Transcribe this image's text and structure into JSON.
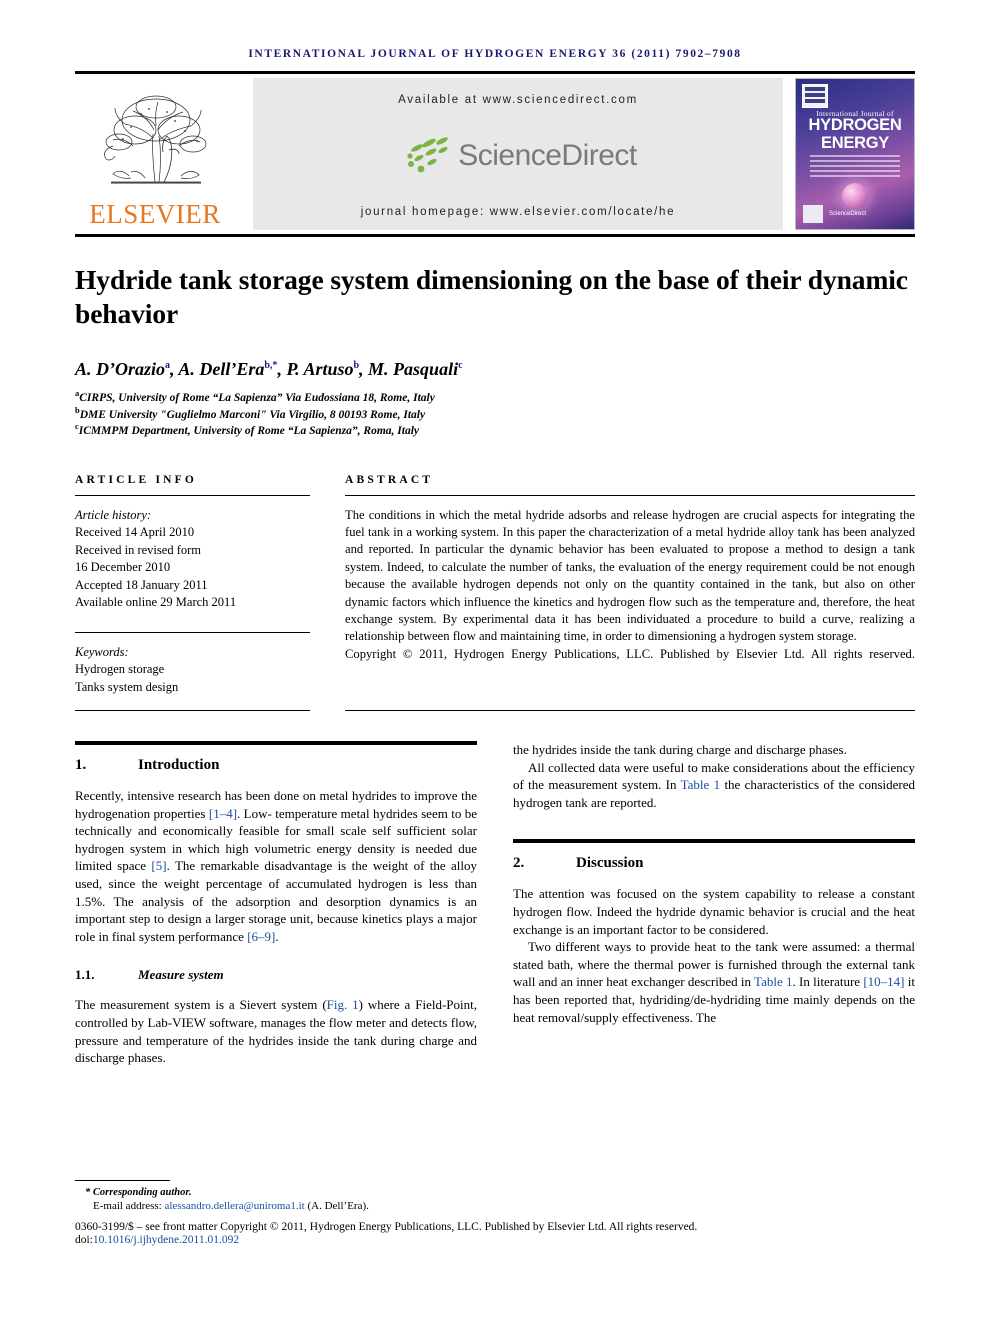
{
  "running_head": "International Journal of Hydrogen Energy 36 (2011) 7902–7908",
  "masthead": {
    "publisher_logo_text": "ELSEVIER",
    "available_at": "Available at www.sciencedirect.com",
    "sciencedirect_wordmark": "ScienceDirect",
    "journal_homepage": "journal homepage: www.elsevier.com/locate/he",
    "cover": {
      "line1": "International Journal of",
      "line2": "HYDROGEN",
      "line3": "ENERGY",
      "footer_brand": "ScienceDirect"
    }
  },
  "article": {
    "title": "Hydride tank storage system dimensioning on the base of their dynamic behavior",
    "authors": [
      {
        "name": "A. D’Orazio",
        "marks": "a"
      },
      {
        "name": "A. Dell’Era",
        "marks": "b,*"
      },
      {
        "name": "P. Artuso",
        "marks": "b"
      },
      {
        "name": "M. Pasquali",
        "marks": "c"
      }
    ],
    "affiliations": [
      {
        "mark": "a",
        "text": "CIRPS, University of Rome “La Sapienza” Via Eudossiana 18, Rome, Italy"
      },
      {
        "mark": "b",
        "text": "DME University \"Guglielmo Marconi\" Via Virgilio, 8 00193 Rome, Italy"
      },
      {
        "mark": "c",
        "text": "ICMMPM Department, University of Rome “La Sapienza”, Roma, Italy"
      }
    ]
  },
  "article_info": {
    "heading": "ARTICLE INFO",
    "history_label": "Article history:",
    "history": [
      "Received 14 April 2010",
      "Received in revised form",
      "16 December 2010",
      "Accepted 18 January 2011",
      "Available online 29 March 2011"
    ],
    "keywords_label": "Keywords:",
    "keywords": [
      "Hydrogen storage",
      "Tanks system design"
    ]
  },
  "abstract": {
    "heading": "ABSTRACT",
    "body": "The conditions in which the metal hydride adsorbs and release hydrogen are crucial aspects for integrating the fuel tank in a working system. In this paper the characterization of a metal hydride alloy tank has been analyzed and reported. In particular the dynamic behavior has been evaluated to propose a method to design a tank system. Indeed, to calculate the number of tanks, the evaluation of the energy requirement could be not enough because the available hydrogen depends not only on the quantity contained in the tank, but also on other dynamic factors which influence the kinetics and hydrogen flow such as the temperature and, therefore, the heat exchange system. By experimental data it has been individuated a procedure to build a curve, realizing a relationship between flow and maintaining time, in order to dimensioning a hydrogen system storage.",
    "copyright": "Copyright © 2011, Hydrogen Energy Publications, LLC. Published by Elsevier Ltd. All rights reserved."
  },
  "sections": {
    "intro": {
      "number": "1.",
      "title": "Introduction",
      "p1_a": "Recently, intensive research has been done on metal hydrides to improve the hydrogenation properties ",
      "p1_ref1": "[1–4]",
      "p1_b": ". Low- temperature metal hydrides seem to be technically and economically feasible for small scale self sufficient solar hydrogen system in which high volumetric energy density is needed due limited space ",
      "p1_ref2": "[5]",
      "p1_c": ". The remarkable disadvantage is the weight of the alloy used, since the weight percentage of accumulated hydrogen is less than 1.5%. The analysis of the adsorption and desorption dynamics is an important step to design a larger storage unit, because kinetics plays a major role in final system performance ",
      "p1_ref3": "[6–9]",
      "p1_d": "."
    },
    "measure": {
      "number": "1.1.",
      "title": "Measure system",
      "p1_a": "The measurement system is a Sievert system (",
      "p1_ref1": "Fig. 1",
      "p1_b": ") where a Field-Point, controlled by Lab-VIEW software, manages the flow meter and detects flow, pressure and temperature of the hydrides inside the tank during charge and discharge phases.",
      "p2_a": "All collected data were useful to make considerations about the efficiency of the measurement system. In ",
      "p2_ref1": "Table 1",
      "p2_b": " the characteristics of the considered hydrogen tank are reported."
    },
    "discussion": {
      "number": "2.",
      "title": "Discussion",
      "p1": "The attention was focused on the system capability to release a constant hydrogen flow. Indeed the hydride dynamic behavior is crucial and the heat exchange is an important factor to be considered.",
      "p2_a": "Two different ways to provide heat to the tank were assumed: a thermal stated bath, where the thermal power is furnished through the external tank wall and an inner heat exchanger described in ",
      "p2_ref1": "Table 1",
      "p2_b": ". In literature ",
      "p2_ref2": "[10–14]",
      "p2_c": " it has been reported that, hydriding/de-hydriding time mainly depends on the heat removal/supply effectiveness. The"
    }
  },
  "footnotes": {
    "corresponding": "* Corresponding author.",
    "email_label": "E-mail address: ",
    "email": "alessandro.dellera@uniroma1.it",
    "email_suffix": " (A. Dell’Era).",
    "issn_line": "0360-3199/$ – see front matter Copyright © 2011, Hydrogen Energy Publications, LLC. Published by Elsevier Ltd. All rights reserved.",
    "doi_label": "doi:",
    "doi": "10.1016/j.ijhydene.2011.01.092"
  },
  "colors": {
    "running_head": "#191970",
    "elsevier_orange": "#E87722",
    "link_blue": "#1a4fa0"
  }
}
